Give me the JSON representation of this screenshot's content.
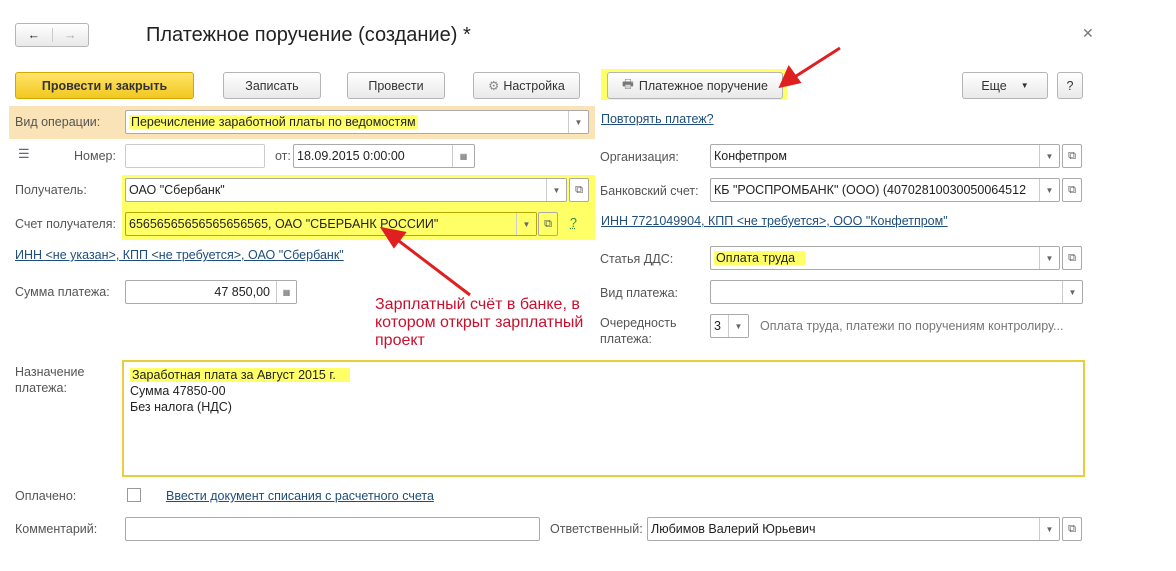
{
  "title": "Платежное поручение (создание) *",
  "toolbar": {
    "post_close": "Провести и закрыть",
    "save": "Записать",
    "post": "Провести",
    "settings": "Настройка",
    "payment_order": "Платежное поручение",
    "more": "Еще",
    "help": "?"
  },
  "form": {
    "operation_label": "Вид операции:",
    "operation_value": "Перечисление заработной платы по ведомостям",
    "repeat_link": "Повторять платеж?",
    "number_label": "Номер:",
    "number_value": "",
    "date_label": "от:",
    "date_value": "18.09.2015  0:00:00",
    "recipient_label": "Получатель:",
    "recipient_value": "ОАО \"Сбербанк\"",
    "recipient_account_label": "Счет получателя:",
    "recipient_account_value": "65656565656565656565, ОАО \"СБЕРБАНК РОССИИ\"",
    "question": "?",
    "recipient_inn_link": "ИНН <не указан>, КПП <не требуется>, ОАО \"Сбербанк\"",
    "sum_label": "Сумма платежа:",
    "sum_value": "47 850,00",
    "org_label": "Организация:",
    "org_value": "Конфетпром",
    "bank_label": "Банковский счет:",
    "bank_value": "КБ \"РОСПРОМБАНК\" (ООО) (40702810030050064512",
    "org_inn_link": "ИНН 7721049904, КПП <не требуется>, ООО \"Конфетпром\"",
    "dds_label": "Статья ДДС:",
    "dds_value": "Оплата труда",
    "paytype_label": "Вид платежа:",
    "paytype_value": "",
    "priority_label": "Очередность платежа:",
    "priority_value": "3",
    "priority_desc": "Оплата труда, платежи по поручениям контролиру...",
    "purpose_label": "Назначение платежа:",
    "purpose_lines": [
      "Заработная плата за Август 2015 г.",
      "Сумма 47850-00",
      "Без налога (НДС)"
    ],
    "paid_label": "Оплачено:",
    "paid_link": "Ввести документ списания с расчетного счета",
    "comment_label": "Комментарий:",
    "comment_value": "",
    "responsible_label": "Ответственный:",
    "responsible_value": "Любимов Валерий Юрьевич"
  },
  "annotation": "Зарплатный счёт в банке, в котором открыт зарплатный проект",
  "colors": {
    "highlight": "#ffff66",
    "arrow": "#e02020",
    "accent": "#f5d23a"
  }
}
